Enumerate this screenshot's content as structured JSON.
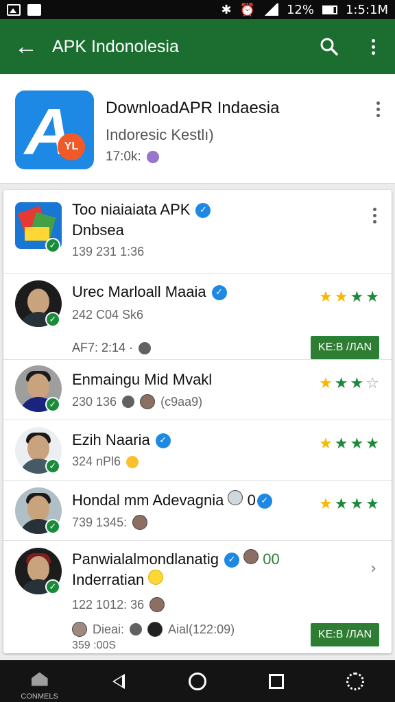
{
  "status_bar": {
    "battery": "12%",
    "time": "1:5:1M"
  },
  "app_bar": {
    "title": "APK Indonolesia",
    "back_icon": "arrow-left-icon",
    "search_icon": "search-icon",
    "menu_icon": "more-vert-icon"
  },
  "header": {
    "title": "DownloadAPR Indaesia",
    "subtitle": "Indoresic Kestlı)",
    "meta": "17:0k:",
    "icon_letter": "A",
    "icon_badge": "YL"
  },
  "rows": [
    {
      "title_line1": "Too niaiaiata APK",
      "title_line2": "Dnbsea",
      "meta": "139 231  1:36"
    },
    {
      "title": "Urec Marloall Maaia",
      "meta": "242 C04  Sk6",
      "stars": [
        "gold",
        "gold",
        "green",
        "green"
      ],
      "sub_text": "AF7: 2:14 ·",
      "sub_button": "KE:B /ЛAN"
    },
    {
      "title": "Enmaingu Mid Mvakl",
      "meta": "230 136",
      "meta_extra": "(c9aa9)",
      "stars": [
        "gold",
        "green",
        "green",
        "empty"
      ]
    },
    {
      "title": "Ezih Naaria",
      "meta": "324 nPl6",
      "stars": [
        "gold",
        "green",
        "green",
        "green"
      ]
    },
    {
      "title": "Hondal mm Adevagnia",
      "title_suffix": "0",
      "meta": "739 1345:",
      "stars": [
        "gold",
        "green",
        "green",
        "green"
      ]
    },
    {
      "title_line1": "Panwialalmondlanatig",
      "title_suffix": "00",
      "title_line2": "Inderratian",
      "meta": "122 1012: 36",
      "sub_left": "Dieai:",
      "sub_right": "Aial(122:09)",
      "sub_line2": "359 :00S",
      "sub_button": "KE:B /ЛAN"
    }
  ],
  "nav": {
    "home_label": "CONMELS"
  },
  "colors": {
    "app_bar": "#1b6e2f",
    "accent_green": "#1b8a3a",
    "star_gold": "#f9b800",
    "verified_blue": "#1e88e5"
  }
}
